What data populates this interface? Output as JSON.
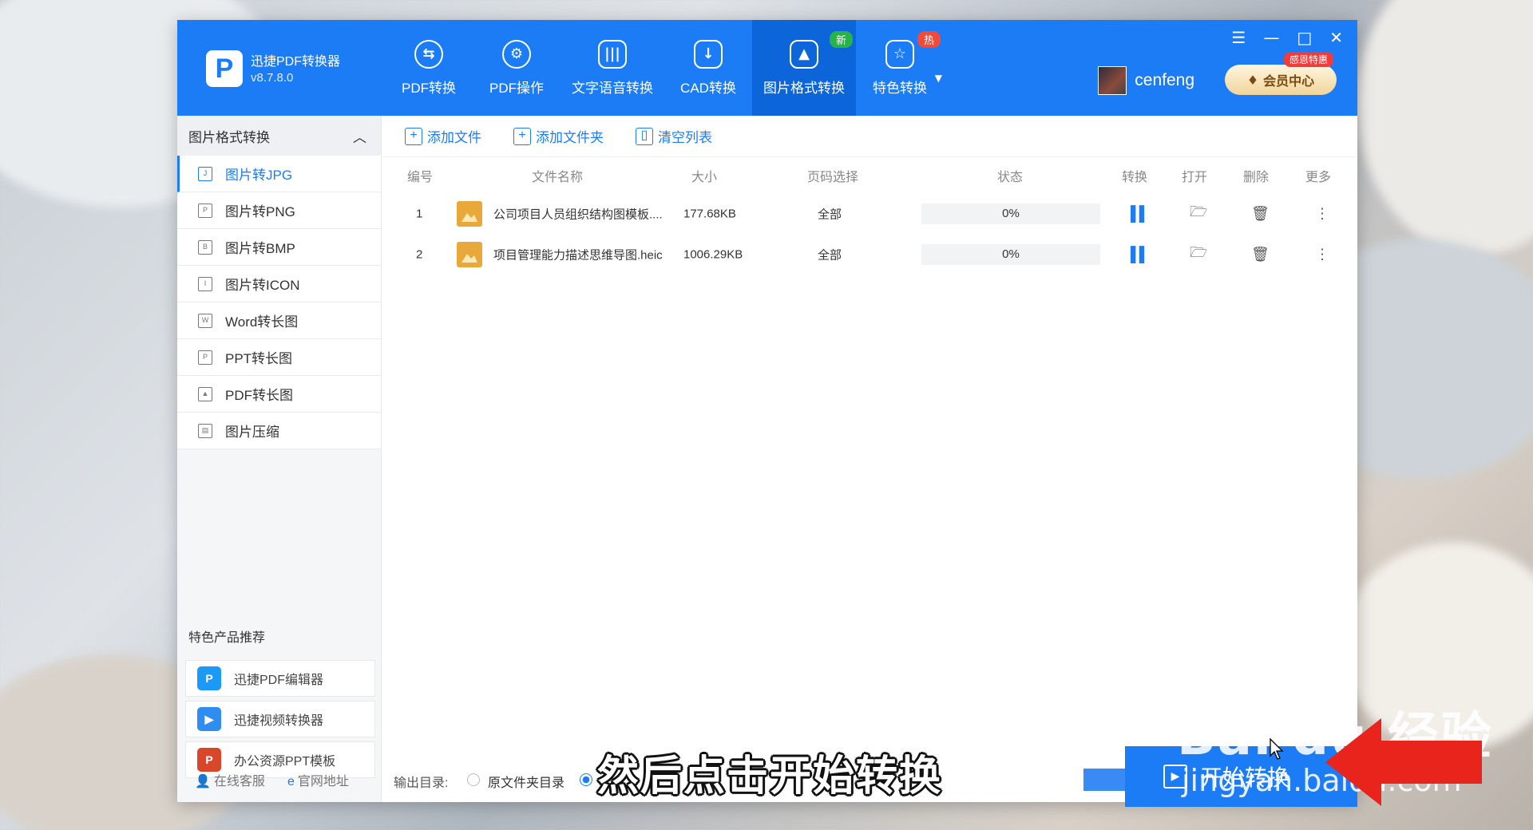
{
  "app": {
    "name": "迅捷PDF转换器",
    "version": "v8.7.8.0",
    "logo_letter": "P"
  },
  "nav": [
    {
      "label": "PDF转换",
      "icon": "pdf-convert-icon",
      "glyph": "⇆",
      "badge": ""
    },
    {
      "label": "PDF操作",
      "icon": "pdf-operate-icon",
      "glyph": "⚙",
      "badge": ""
    },
    {
      "label": "文字语音转换",
      "icon": "audio-wave-icon",
      "glyph": "|||",
      "badge": ""
    },
    {
      "label": "CAD转换",
      "icon": "cad-icon",
      "glyph": "↓",
      "badge": ""
    },
    {
      "label": "图片格式转换",
      "icon": "image-icon",
      "glyph": "▲",
      "badge": "新",
      "active": true
    },
    {
      "label": "特色转换",
      "icon": "star-convert-icon",
      "glyph": "☆",
      "badge": "热"
    }
  ],
  "window_controls": {
    "menu": "☰",
    "minimize": "—",
    "maximize": "□",
    "close": "✕"
  },
  "user": {
    "name": "cenfeng"
  },
  "vip": {
    "label": "会员中心",
    "tag": "感恩特惠"
  },
  "sidebar": {
    "header": "图片格式转换",
    "items": [
      {
        "label": "图片转JPG",
        "icon": "jpg-icon",
        "glyph": "J",
        "active": true
      },
      {
        "label": "图片转PNG",
        "icon": "png-icon",
        "glyph": "P"
      },
      {
        "label": "图片转BMP",
        "icon": "bmp-icon",
        "glyph": "B"
      },
      {
        "label": "图片转ICON",
        "icon": "ico-icon",
        "glyph": "I"
      },
      {
        "label": "Word转长图",
        "icon": "word-icon",
        "glyph": "W"
      },
      {
        "label": "PPT转长图",
        "icon": "ppt-icon",
        "glyph": "P"
      },
      {
        "label": "PDF转长图",
        "icon": "pdf-icon",
        "glyph": "▲"
      },
      {
        "label": "图片压缩",
        "icon": "compress-icon",
        "glyph": "▤"
      }
    ],
    "featured_title": "特色产品推荐",
    "featured": [
      {
        "label": "迅捷PDF编辑器",
        "color": "#1b9af5",
        "glyph": "P"
      },
      {
        "label": "迅捷视频转换器",
        "color": "#2f8cf0",
        "glyph": "▶"
      },
      {
        "label": "办公资源PPT模板",
        "color": "#d9472b",
        "glyph": "P"
      }
    ],
    "links": [
      {
        "label": "在线客服",
        "glyph": "👤"
      },
      {
        "label": "官网地址",
        "glyph": "e"
      }
    ]
  },
  "toolbar": {
    "add_file": "添加文件",
    "add_folder": "添加文件夹",
    "clear_list": "清空列表"
  },
  "table": {
    "headers": [
      "编号",
      "文件名称",
      "大小",
      "页码选择",
      "状态",
      "转换",
      "打开",
      "删除",
      "更多"
    ],
    "rows": [
      {
        "no": "1",
        "name": "公司项目人员组织结构图模板....",
        "size": "177.68KB",
        "pages": "全部",
        "status": "0%"
      },
      {
        "no": "2",
        "name": "项目管理能力描述思维导图.heic",
        "size": "1006.29KB",
        "pages": "全部",
        "status": "0%"
      }
    ]
  },
  "footer": {
    "output_label": "输出目录:",
    "option_source": "原文件夹目录",
    "open_dir": "开文件目录",
    "start_button": "开始转换"
  },
  "overlay": {
    "subtitle": "然后点击开始转换",
    "watermark_logo": "Bai du 经验",
    "watermark_url": "jingyan.baidu.com"
  }
}
